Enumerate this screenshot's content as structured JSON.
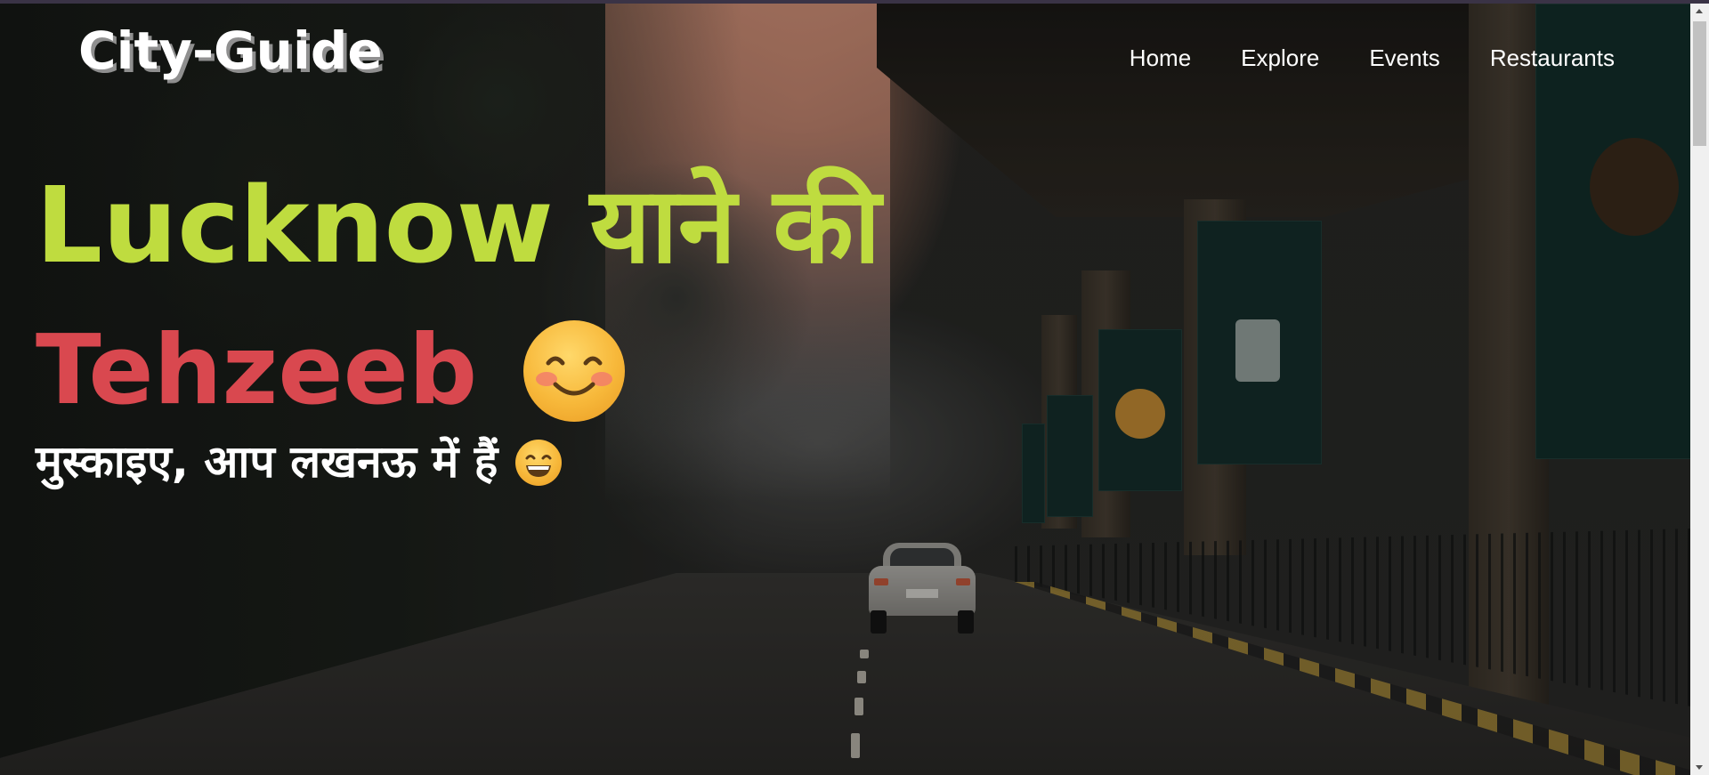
{
  "header": {
    "logo_text": "City-Guide",
    "nav": [
      {
        "label": "Home"
      },
      {
        "label": "Explore"
      },
      {
        "label": "Events"
      },
      {
        "label": "Restaurants"
      }
    ]
  },
  "hero": {
    "headline_line1": "Lucknow याने की",
    "headline_word2": "Tehzeeb",
    "headline_emoji": "smiling-face-with-smiling-eyes-icon",
    "subheadline": "मुस्काइए, आप लखनऊ में हैं",
    "subheadline_emoji": "grinning-face-icon",
    "colors": {
      "line1": "#bfdc3f",
      "line2": "#d9484f",
      "line3": "#ffffff"
    },
    "background": "city-road-under-flyover-photo"
  }
}
